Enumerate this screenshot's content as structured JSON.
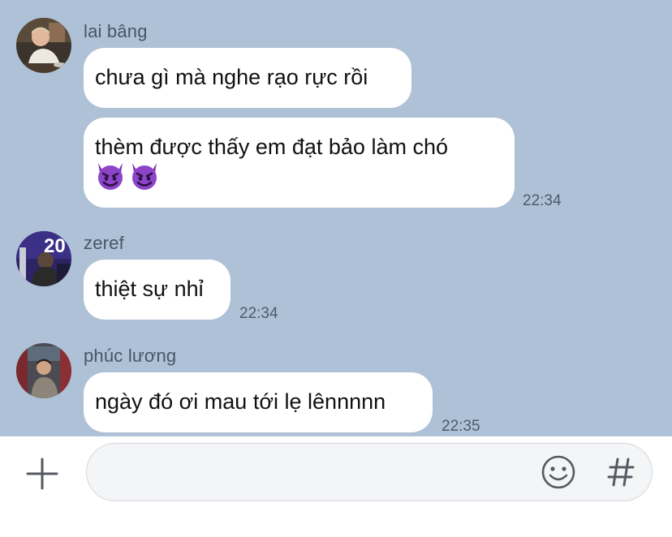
{
  "messages": [
    {
      "sender": "lai bâng",
      "avatar_icon": "profile-photo-lai-bang",
      "bubbles": [
        {
          "text": "chưa gì mà nghe rạo rực rồi"
        },
        {
          "text": "thèm được thấy em đạt bảo làm chó",
          "emojis": [
            "smiling-imp-icon",
            "smiling-imp-icon"
          ],
          "time": "22:34"
        }
      ]
    },
    {
      "sender": "zeref",
      "avatar_icon": "profile-photo-zeref",
      "bubbles": [
        {
          "text": "thiệt sự nhỉ",
          "time": "22:34"
        }
      ]
    },
    {
      "sender": "phúc lương",
      "avatar_icon": "profile-photo-phuc-luong",
      "bubbles": [
        {
          "text": "ngày đó ơi mau tới lẹ lênnnnn",
          "time": "22:35"
        }
      ]
    }
  ],
  "input_bar": {
    "placeholder": "",
    "plus_icon": "plus-icon",
    "emoji_icon": "smiley-icon",
    "hash_icon": "hash-icon"
  },
  "colors": {
    "chat_background": "#aec1d6",
    "bubble": "#ffffff",
    "emoji_purple": "#8e44c9"
  }
}
